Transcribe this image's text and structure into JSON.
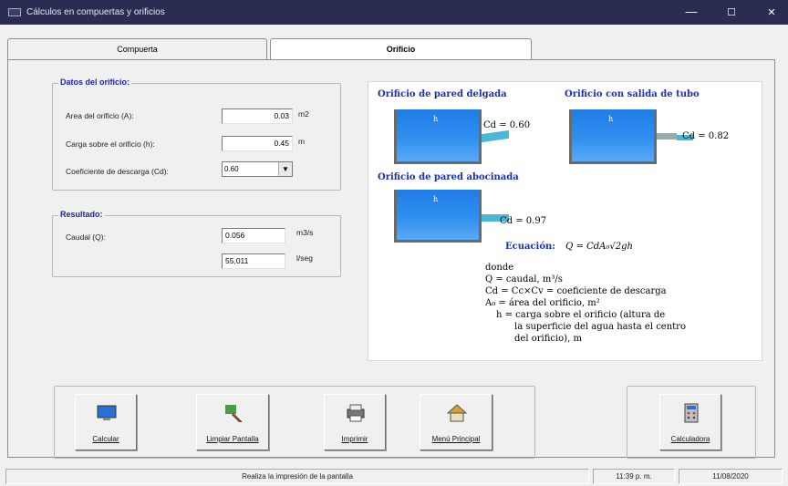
{
  "window": {
    "title": "Cálculos en compuertas y orificios",
    "minimize": "—",
    "maximize": "☐",
    "close": "✕"
  },
  "tabs": [
    {
      "label": "Compuerta"
    },
    {
      "label": "Orificio"
    }
  ],
  "datos": {
    "title": "Datos del orificio:",
    "area_label": "Area del orificio (A):",
    "area_value": "0.03",
    "area_unit": "m2",
    "carga_label": "Carga sobre el orificio (h):",
    "carga_value": "0.45",
    "carga_unit": "m",
    "coef_label": "Coeficiente de descarga (Cd):",
    "coef_value": "0.60"
  },
  "resultado": {
    "title": "Resultado:",
    "caudal_label": "Caudal (Q):",
    "caudal_m3s": "0.056",
    "unit_m3s": "m3/s",
    "caudal_ls": "55,011",
    "unit_ls": "l/seg"
  },
  "diagram": {
    "h1": "Orificio de pared delgada",
    "h2": "Orificio con salida de tubo",
    "h3": "Orificio de pared abocinada",
    "h_symbol": "h",
    "cd1": "Cd = 0.60",
    "cd2": "Cd = 0.82",
    "cd3": "Cd = 0.97",
    "eq_label": "Ecuación:",
    "eq_formula": "Q = CdA₀√2gh",
    "lines": [
      "donde",
      "Q = caudal, m³/s",
      "Cd = Cc×Cv = coeficiente de descarga",
      "A₀ = área del orificio, m²",
      "h = carga sobre el orificio (altura de",
      "la superficie del agua hasta el centro",
      "del orificio), m"
    ]
  },
  "buttons": {
    "calcular": "Calcular",
    "limpiar": "Limpiar Pantalla",
    "imprimir": "Imprimir",
    "menu": "Menú Principal",
    "calculadora": "Calculadora"
  },
  "status": {
    "message": "Realiza la impresión de la pantalla",
    "time": "11:39 p. m.",
    "date": "11/08/2020"
  },
  "colors": {
    "accent_blue": "#1a2fb5",
    "water": "#2f8ff0",
    "titlebar": "#2a2c52"
  }
}
